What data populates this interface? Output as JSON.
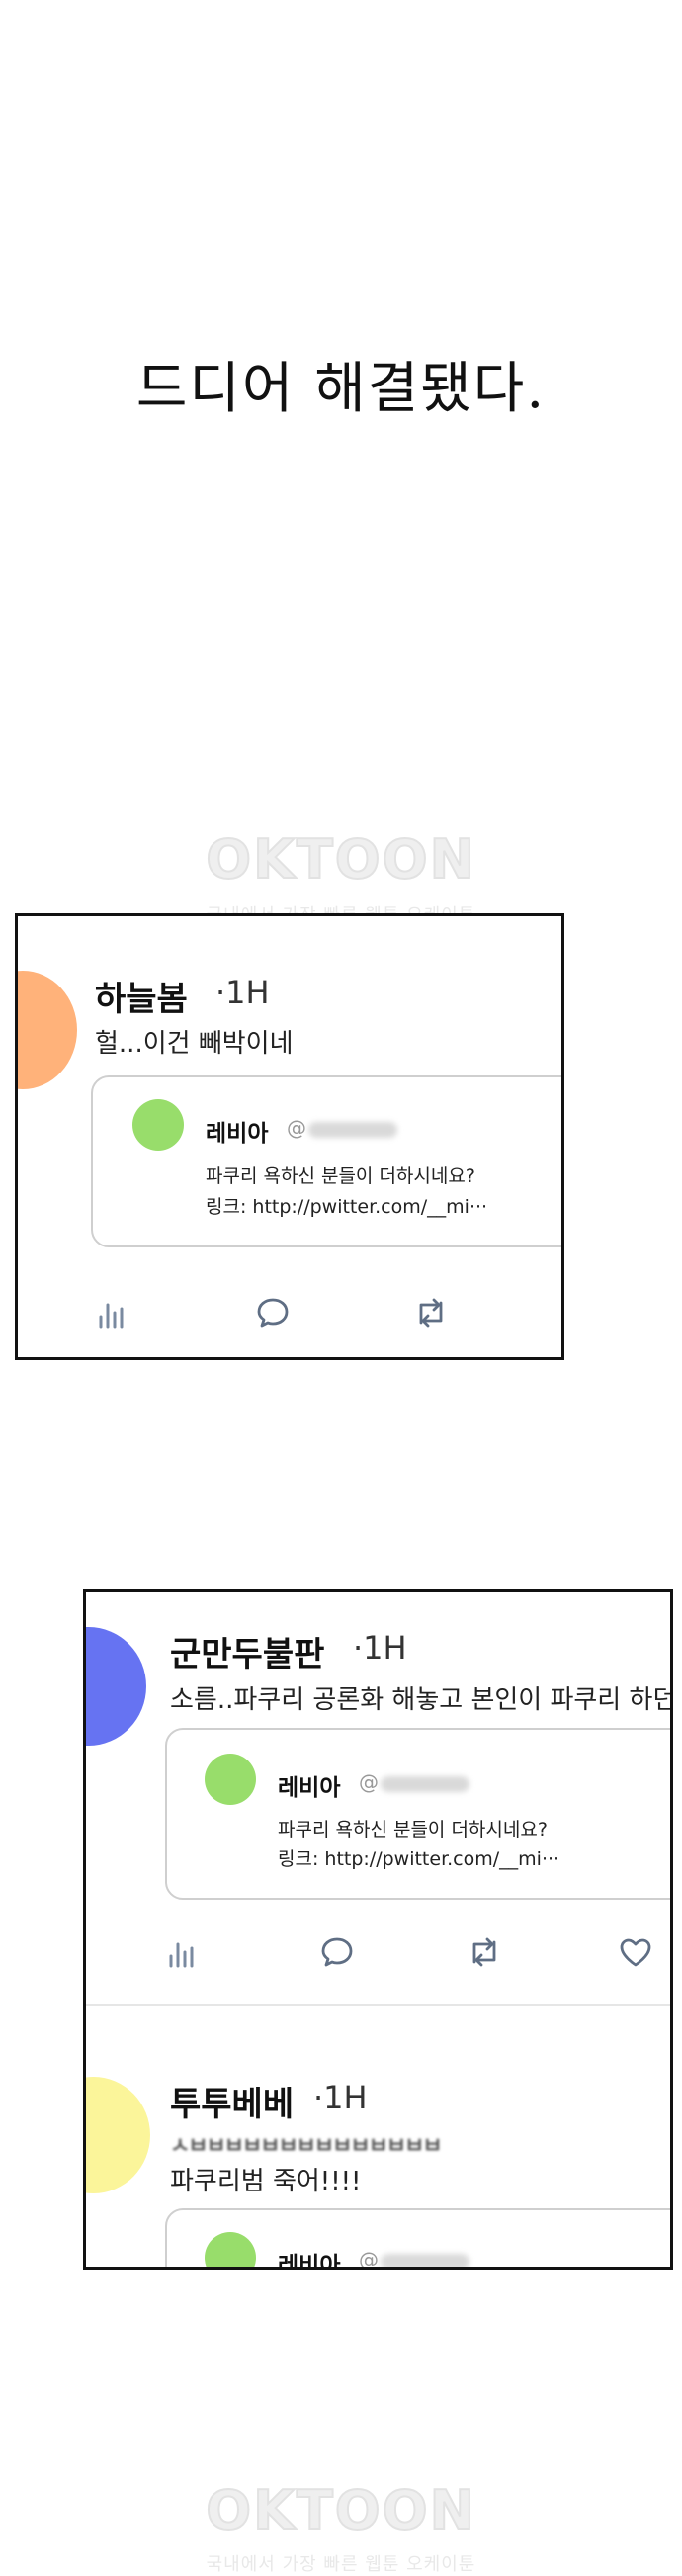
{
  "narration": "드디어 해결됐다.",
  "watermark": {
    "logo": "OKTOON",
    "tagline": "국내에서 가장 빠른 웹툰 오케이툰"
  },
  "panel1": {
    "user": "하늘봄",
    "time": "·1H",
    "text": "헐...이건 빼박이네",
    "quote": {
      "name": "레비아",
      "handle": "@",
      "line1": "파쿠리 욕하신 분들이 더하시네요?",
      "line2": "링크: http://pwitter.com/__mi···"
    }
  },
  "panel2": {
    "post1": {
      "user": "군만두불판",
      "time": "·1H",
      "text": "소름..파쿠리 공론화 해놓고 본인이 파쿠리 하던",
      "quote": {
        "name": "레비아",
        "handle": "@",
        "line1": "파쿠리 욕하신 분들이 더하시네요?",
        "line2": "링크: http://pwitter.com/__mi···"
      }
    },
    "post2": {
      "user": "투투베베",
      "time": "·1H",
      "scribble": "ㅅㅂㅂㅂㅂㅂㅂㅂㅂㅂㅂㅂㅂㅂㅂ",
      "text": "파쿠리범 죽어!!!!",
      "quote": {
        "name": "레비아",
        "handle": "@"
      }
    }
  },
  "colors": {
    "avatar_haneulbom": "#ffb27a",
    "avatar_gunmandu": "#6673f2",
    "avatar_tutubebe": "#fbf59a",
    "avatar_levia": "#98dd6b"
  }
}
